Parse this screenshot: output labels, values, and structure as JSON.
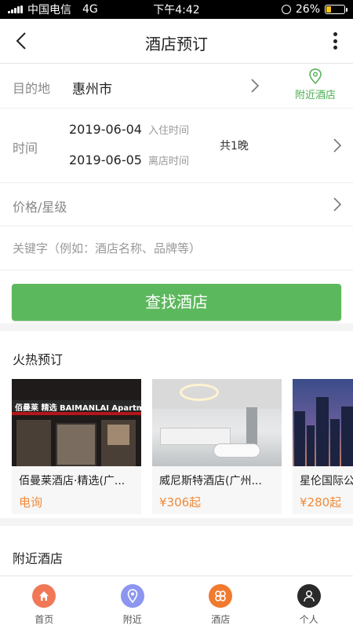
{
  "status_bar": {
    "carrier": "中国电信",
    "network": "4G",
    "time": "下午4:42",
    "battery": "26%",
    "battery_level": 0.26
  },
  "header": {
    "title": "酒店预订"
  },
  "form": {
    "destination": {
      "label": "目的地",
      "value": "惠州市",
      "nearby_label": "附近酒店"
    },
    "time": {
      "label": "时间",
      "checkin_date": "2019-06-04",
      "checkin_label": "入住时间",
      "checkout_date": "2019-06-05",
      "checkout_label": "离店时间",
      "nights": "共1晚"
    },
    "price": {
      "label": "价格/星级"
    },
    "keyword": {
      "placeholder": "关键字（例如：酒店名称、品牌等）"
    },
    "search_button": "查找酒店"
  },
  "hot": {
    "title": "火热预订",
    "cards": [
      {
        "name": "佰曼莱酒店·精选(广...",
        "price": "电询",
        "sign_text": "佰曼莱  精选  BAIMANLAI  Apartme"
      },
      {
        "name": "威尼斯特酒店(广州...",
        "price": "¥306起"
      },
      {
        "name": "星伦国际公",
        "price": "¥280起"
      }
    ]
  },
  "nearby_section": {
    "title": "附近酒店"
  },
  "tabbar": {
    "items": [
      {
        "label": "首页",
        "color": "#f07857"
      },
      {
        "label": "附近",
        "color": "#8c96f0"
      },
      {
        "label": "酒店",
        "color": "#f07a2f"
      },
      {
        "label": "个人",
        "color": "#2a2a2a"
      }
    ]
  },
  "colors": {
    "accent_green": "#5cb85c",
    "price_orange": "#f08a3a"
  }
}
